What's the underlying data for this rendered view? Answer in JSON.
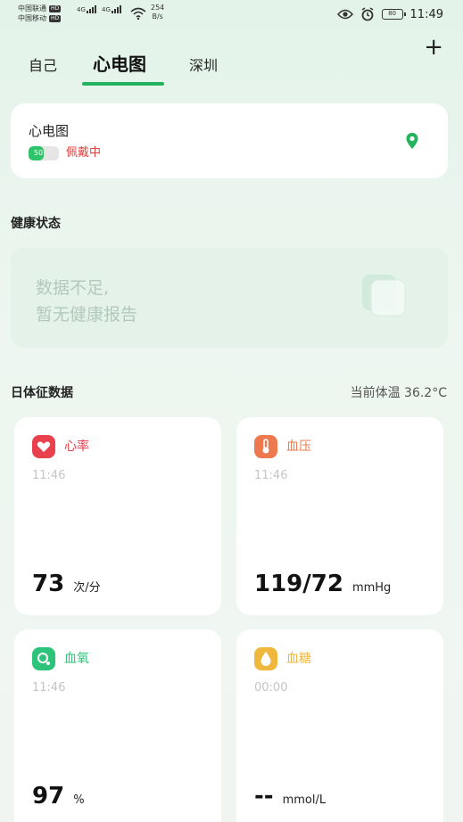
{
  "status_bar": {
    "carrier1": "中国联通",
    "carrier2": "中国移动",
    "hd": "HD",
    "net": "4G",
    "speed_value": "254",
    "speed_unit": "B/s",
    "battery": "80",
    "time": "11:49"
  },
  "tabs": [
    {
      "label": "自己",
      "active": false
    },
    {
      "label": "心电图",
      "active": true
    },
    {
      "label": "深圳",
      "active": false
    }
  ],
  "add_label": "+",
  "device": {
    "name": "心电图",
    "battery_percent": 50,
    "battery_label": "50",
    "wear_status": "佩戴中",
    "icon": "location-pin-icon"
  },
  "health": {
    "title": "健康状态",
    "message": "数据不足,\n暂无健康报告"
  },
  "vitals": {
    "title": "日体征数据",
    "temperature": "当前体温 36.2°C",
    "cards": [
      {
        "name": "心率",
        "time": "11:46",
        "value": "73",
        "unit": "次/分",
        "color": "#e8414d",
        "icon": "heart-icon"
      },
      {
        "name": "血压",
        "time": "11:46",
        "value": "119/72",
        "unit": "mmHg",
        "color": "#ec7a4e",
        "icon": "thermometer-icon"
      },
      {
        "name": "血氧",
        "time": "11:46",
        "value": "97",
        "unit": "%",
        "color": "#2ec37a",
        "icon": "oxygen-icon"
      },
      {
        "name": "血糖",
        "time": "00:00",
        "value": "--",
        "unit": "mmol/L",
        "color": "#efb73c",
        "icon": "drop-icon"
      }
    ]
  },
  "colors": {
    "accent": "#24b35f",
    "warning": "#e0413f"
  }
}
